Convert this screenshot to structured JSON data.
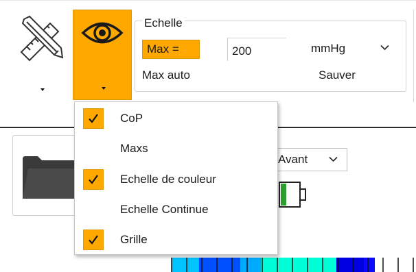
{
  "toolbar": {
    "tools_button": {
      "icon": "ruler-pencil-icon"
    },
    "view_button": {
      "icon": "eye-icon",
      "active": true
    },
    "accent_color": "#ffa800"
  },
  "echelle": {
    "title": "Echelle",
    "max_label": "Max =",
    "max_value": "200",
    "unit": "mmHg",
    "max_auto_label": "Max auto",
    "save_label": "Sauver"
  },
  "content": {
    "folder_icon": "folder-icon",
    "view_select": "Avant",
    "battery_icon": "battery-icon"
  },
  "menu": {
    "items": [
      {
        "label": "CoP",
        "checked": true
      },
      {
        "label": "Maxs",
        "checked": false
      },
      {
        "label": "Echelle de couleur",
        "checked": true
      },
      {
        "label": "Echelle Continue",
        "checked": false
      },
      {
        "label": "Grille",
        "checked": true
      }
    ]
  }
}
